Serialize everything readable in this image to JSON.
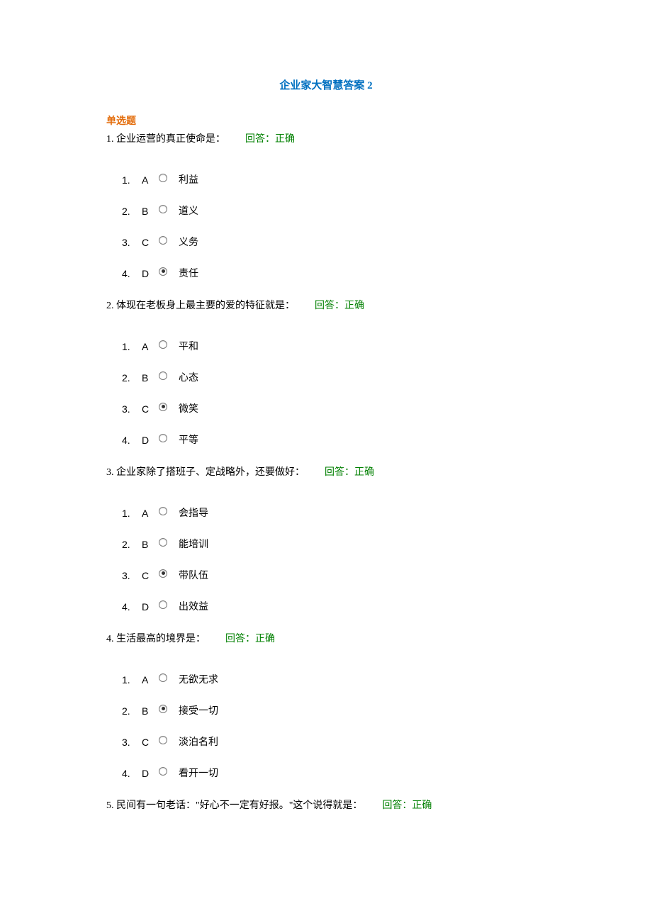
{
  "title": "企业家大智慧答案 2",
  "section": "单选题",
  "feedback_label": "回答：正确",
  "questions": [
    {
      "num": "1.",
      "text": "企业运营的真正使命是：",
      "options": [
        {
          "n": "1.",
          "letter": "A",
          "label": "利益",
          "selected": false
        },
        {
          "n": "2.",
          "letter": "B",
          "label": "道义",
          "selected": false
        },
        {
          "n": "3.",
          "letter": "C",
          "label": "义务",
          "selected": false
        },
        {
          "n": "4.",
          "letter": "D",
          "label": "责任",
          "selected": true
        }
      ]
    },
    {
      "num": "2.",
      "text": "体现在老板身上最主要的爱的特征就是：",
      "options": [
        {
          "n": "1.",
          "letter": "A",
          "label": "平和",
          "selected": false
        },
        {
          "n": "2.",
          "letter": "B",
          "label": "心态",
          "selected": false
        },
        {
          "n": "3.",
          "letter": "C",
          "label": "微笑",
          "selected": true
        },
        {
          "n": "4.",
          "letter": "D",
          "label": "平等",
          "selected": false
        }
      ]
    },
    {
      "num": "3.",
      "text": "企业家除了搭班子、定战略外，还要做好：",
      "options": [
        {
          "n": "1.",
          "letter": "A",
          "label": "会指导",
          "selected": false
        },
        {
          "n": "2.",
          "letter": "B",
          "label": "能培训",
          "selected": false
        },
        {
          "n": "3.",
          "letter": "C",
          "label": "带队伍",
          "selected": true
        },
        {
          "n": "4.",
          "letter": "D",
          "label": "出效益",
          "selected": false
        }
      ]
    },
    {
      "num": "4.",
      "text": "生活最高的境界是：",
      "options": [
        {
          "n": "1.",
          "letter": "A",
          "label": "无欲无求",
          "selected": false
        },
        {
          "n": "2.",
          "letter": "B",
          "label": "接受一切",
          "selected": true
        },
        {
          "n": "3.",
          "letter": "C",
          "label": "淡泊名利",
          "selected": false
        },
        {
          "n": "4.",
          "letter": "D",
          "label": "看开一切",
          "selected": false
        }
      ]
    },
    {
      "num": "5.",
      "text": "民间有一句老话：\"好心不一定有好报。\"这个说得就是：",
      "options": []
    }
  ]
}
